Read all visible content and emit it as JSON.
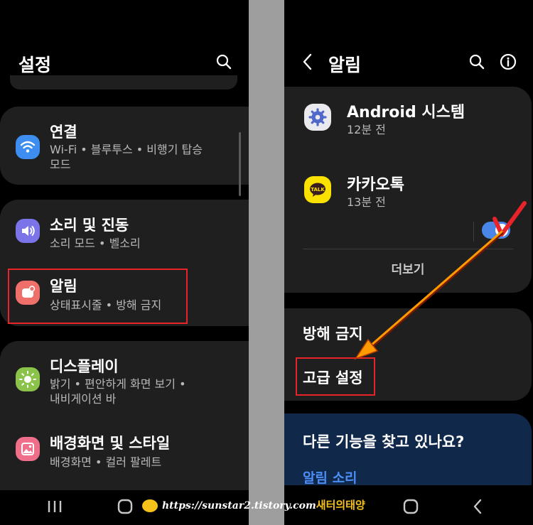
{
  "left": {
    "title": "설정",
    "groups": [
      {
        "items": [
          {
            "title": "연결",
            "subtitle": "Wi-Fi • 블루투스 • 비행기 탑승\n모드",
            "icon": "wifi-icon",
            "color": "#3d8ef0"
          }
        ]
      },
      {
        "items": [
          {
            "title": "소리 및 진동",
            "subtitle": "소리 모드 • 벨소리",
            "icon": "volume-icon",
            "color": "#7b74e8"
          },
          {
            "title": "알림",
            "subtitle": "상태표시줄 • 방해 금지",
            "icon": "notification-icon",
            "color": "#ef6f6a"
          }
        ]
      },
      {
        "items": [
          {
            "title": "디스플레이",
            "subtitle": "밝기 • 편안하게 화면 보기 •\n내비게이션 바",
            "icon": "brightness-icon",
            "color": "#8bc34a"
          },
          {
            "title": "배경화면 및 스타일",
            "subtitle": "배경화면 • 컬러 팔레트",
            "icon": "wallpaper-icon",
            "color": "#ef6f8a"
          }
        ]
      }
    ]
  },
  "right": {
    "title": "알림",
    "apps": [
      {
        "name": "Android 시스템",
        "time": "12분 전",
        "icon": "android-system-icon"
      },
      {
        "name": "카카오톡",
        "time": "13분 전",
        "icon": "kakaotalk-icon",
        "toggle_on": true
      }
    ],
    "more": "더보기",
    "dnd": "방해 금지",
    "advanced": "고급 설정",
    "suggest_title": "다른 기능을 찾고 있나요?",
    "suggest_link": "알림 소리",
    "kakao_badge": "TALK"
  },
  "watermark": {
    "url": "https://sunstar2.tistory.com",
    "name": "새터의태양"
  },
  "colors": {
    "card": "#1f1f1f",
    "accent_blue": "#4a86e8",
    "highlight_red": "#e8232a",
    "arrow_orange": "#ff9b00",
    "suggest_bg": "#10284a",
    "link_blue": "#4c8df6"
  }
}
